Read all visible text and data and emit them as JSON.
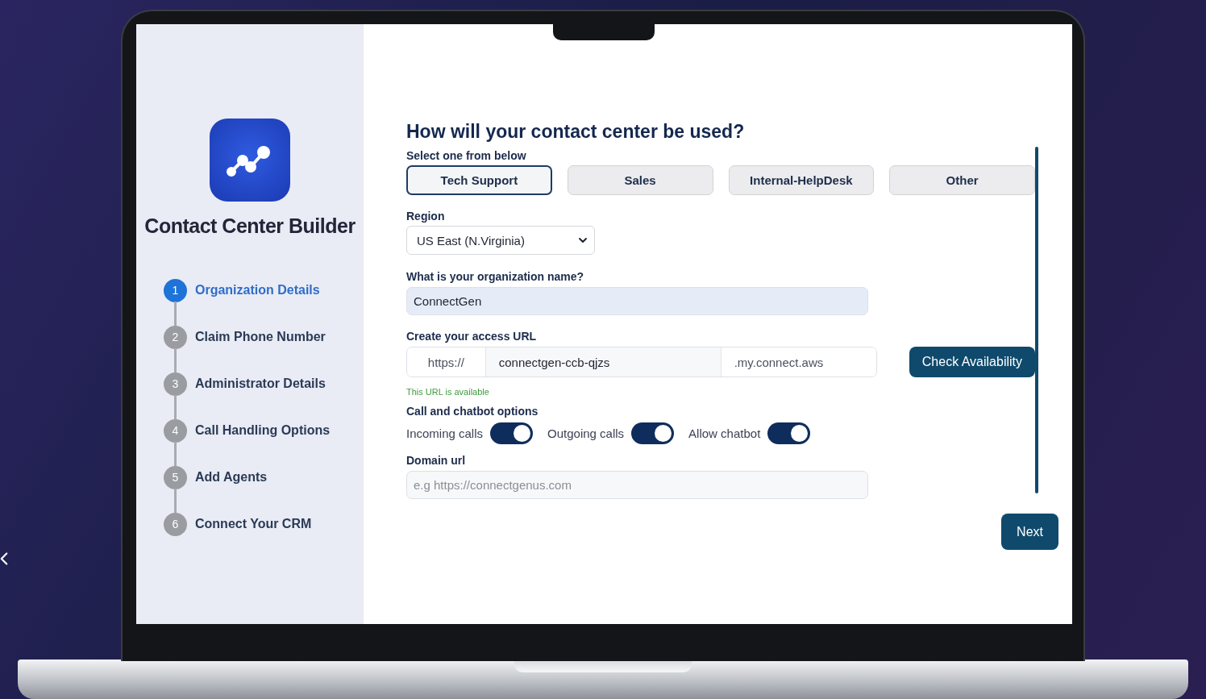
{
  "app": {
    "title": "Contact Center Builder"
  },
  "steps": [
    {
      "number": "1",
      "label": "Organization Details",
      "selected": true
    },
    {
      "number": "2",
      "label": "Claim Phone Number",
      "selected": false
    },
    {
      "number": "3",
      "label": "Administrator Details",
      "selected": false
    },
    {
      "number": "4",
      "label": "Call Handling Options",
      "selected": false
    },
    {
      "number": "5",
      "label": "Add Agents",
      "selected": false
    },
    {
      "number": "6",
      "label": "Connect Your CRM",
      "selected": false
    }
  ],
  "form": {
    "heading": "How will your contact center be used?",
    "subheading": "Select one from below",
    "usage_options": [
      {
        "label": "Tech Support",
        "selected": true
      },
      {
        "label": "Sales",
        "selected": false
      },
      {
        "label": "Internal-HelpDesk",
        "selected": false
      },
      {
        "label": "Other",
        "selected": false
      }
    ],
    "region": {
      "label": "Region",
      "value": "US East (N.Virginia)"
    },
    "org_name": {
      "label": "What is your organization name?",
      "value": "ConnectGen"
    },
    "access_url": {
      "label": "Create your access URL",
      "prefix": "https://",
      "value": "connectgen-ccb-qjzs",
      "suffix": ".my.connect.aws",
      "button": "Check Availability",
      "status": "This URL is available"
    },
    "options": {
      "label": "Call and chatbot options",
      "toggles": [
        {
          "label": "Incoming calls",
          "on": true
        },
        {
          "label": "Outgoing calls",
          "on": true
        },
        {
          "label": "Allow chatbot",
          "on": true
        }
      ]
    },
    "domain": {
      "label": "Domain url",
      "placeholder": "e.g https://connectgenus.com"
    },
    "next_button": "Next"
  }
}
